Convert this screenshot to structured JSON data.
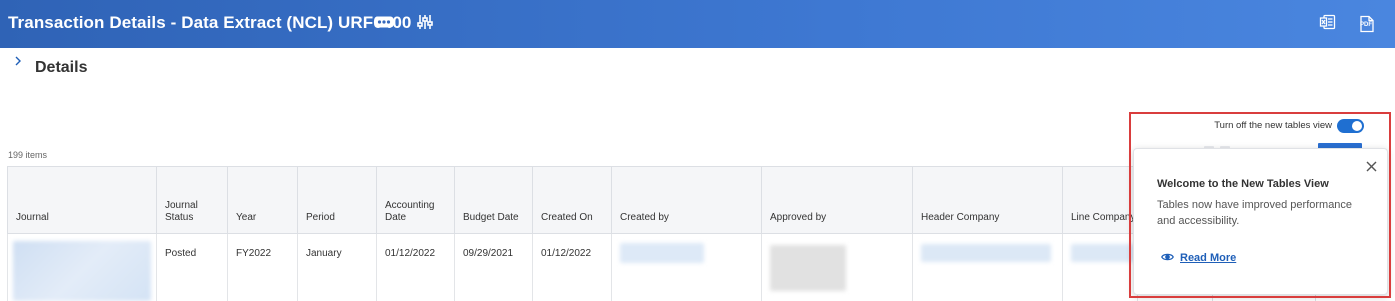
{
  "header": {
    "title": "Transaction Details - Data Extract (NCL) URF0400",
    "icons": {
      "more": "more-icon",
      "filter": "filter-settings-icon",
      "excel": "export-excel-icon",
      "pdf": "export-pdf-icon"
    },
    "pdf_label": "PDF",
    "gradient_colors": [
      "#2f63b6",
      "#4a86df"
    ]
  },
  "section": {
    "title": "Details"
  },
  "table": {
    "count_label": "199 items",
    "columns": [
      "Journal",
      "Journal Status",
      "Year",
      "Period",
      "Accounting Date",
      "Budget Date",
      "Created On",
      "Created by",
      "Approved by",
      "Header Company",
      "Line Company"
    ],
    "rows": [
      {
        "journal": "",
        "journal_status": "Posted",
        "year": "FY2022",
        "period": "January",
        "accounting_date": "01/12/2022",
        "budget_date": "09/29/2021",
        "created_on": "01/12/2022",
        "created_by": "",
        "approved_by": "",
        "header_company": "",
        "line_company": ""
      }
    ]
  },
  "tables_view": {
    "toggle_label": "Turn off the new tables view",
    "toggle_on": true,
    "accent": "#1f6fd1"
  },
  "popover": {
    "title": "Welcome to the New Tables View",
    "body": "Tables now have improved performance and accessibility.",
    "link_label": "Read More",
    "link_color": "#1f5fb8"
  },
  "highlight_color": "#d93d3d"
}
